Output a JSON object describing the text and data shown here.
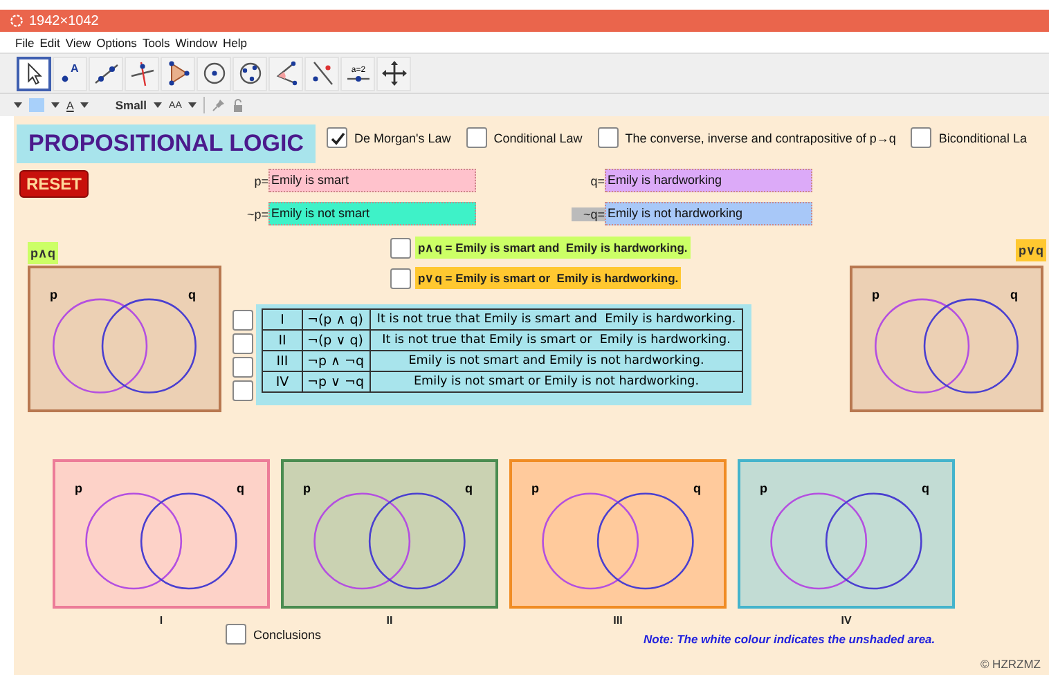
{
  "window": {
    "title": "1942×1042"
  },
  "menu": [
    "File",
    "Edit",
    "View",
    "Options",
    "Tools",
    "Window",
    "Help"
  ],
  "toolbar": [
    {
      "kind": "move",
      "selected": true
    },
    {
      "kind": "point",
      "selected": false,
      "label": "A"
    },
    {
      "kind": "line",
      "selected": false
    },
    {
      "kind": "perpendicular",
      "selected": false
    },
    {
      "kind": "polygon",
      "selected": false
    },
    {
      "kind": "circle",
      "selected": false
    },
    {
      "kind": "circle3",
      "selected": false
    },
    {
      "kind": "angle",
      "selected": false
    },
    {
      "kind": "reflect",
      "selected": false
    },
    {
      "kind": "slider",
      "selected": false,
      "label": "a=2"
    },
    {
      "kind": "pan",
      "selected": false
    }
  ],
  "style_bar": {
    "text_label": "A",
    "size": "Small",
    "size_label": "AA"
  },
  "canvas": {
    "title": "PROPOSITIONAL LOGIC",
    "laws": [
      {
        "label": "De Morgan's Law",
        "checked": true
      },
      {
        "label": "Conditional Law",
        "checked": false
      },
      {
        "label": "The converse, inverse and contrapositive of p→q",
        "checked": false
      },
      {
        "label": "Biconditional La",
        "checked": false
      }
    ],
    "reset": "RESET",
    "propositions": [
      {
        "symbol": "p=",
        "value": "Emily is smart",
        "color": "#ffc2cc"
      },
      {
        "symbol": "~p=",
        "value": "Emily is not smart",
        "color": "#3ef2c8"
      },
      {
        "symbol": "q=",
        "value": "Emily is hardworking",
        "color": "#dcaaf8"
      },
      {
        "symbol": "~q=",
        "value": "Emily is not hardworking",
        "color": "#a8c8f8"
      }
    ],
    "top_venns": [
      {
        "label": "p∧q",
        "color": "#ccff66",
        "set_labels": [
          "p",
          "q"
        ]
      },
      {
        "label": "p∨q",
        "color": "#ffc830",
        "set_labels": [
          "p",
          "q"
        ]
      }
    ],
    "statements": [
      {
        "text": "p∧q = Emily is smart and  Emily is hardworking.",
        "checked": false,
        "color": "#ccff66"
      },
      {
        "text": "p∨q = Emily is smart or  Emily is hardworking.",
        "checked": false,
        "color": "#ffc830"
      }
    ],
    "table": [
      {
        "numeral": "I",
        "formula": "¬(p ∧ q)",
        "text": "It is not true that Emily is smart and  Emily is hardworking.",
        "checked": false
      },
      {
        "numeral": "II",
        "formula": "¬(p ∨ q)",
        "text": "It is not true that Emily is smart or  Emily is hardworking.",
        "checked": false
      },
      {
        "numeral": "III",
        "formula": "¬p ∧ ¬q",
        "text": "Emily is not smart and Emily is not hardworking.",
        "checked": false
      },
      {
        "numeral": "IV",
        "formula": "¬p ∨ ¬q",
        "text": "Emily is not smart or Emily is not hardworking.",
        "checked": false
      }
    ],
    "diagrams": [
      {
        "numeral": "I",
        "color": "#fdd2c8",
        "frame": {
          "color": "#ec7c98"
        },
        "set_labels": [
          "p",
          "q"
        ]
      },
      {
        "numeral": "II",
        "color": "#cad2b2",
        "frame": {
          "color": "#4a8c50"
        },
        "set_labels": [
          "p",
          "q"
        ]
      },
      {
        "numeral": "III",
        "color": "#ffca9c",
        "frame": {
          "color": "#f08c24"
        },
        "set_labels": [
          "p",
          "q"
        ]
      },
      {
        "numeral": "IV",
        "color": "#c2dcd4",
        "frame": {
          "color": "#44b4cc"
        },
        "set_labels": [
          "p",
          "q"
        ]
      }
    ],
    "conclusions": {
      "label": "Conclusions",
      "checked": false
    },
    "note": "Note: The white colour indicates the unshaded area.",
    "credit": "© HZRZMZ"
  }
}
